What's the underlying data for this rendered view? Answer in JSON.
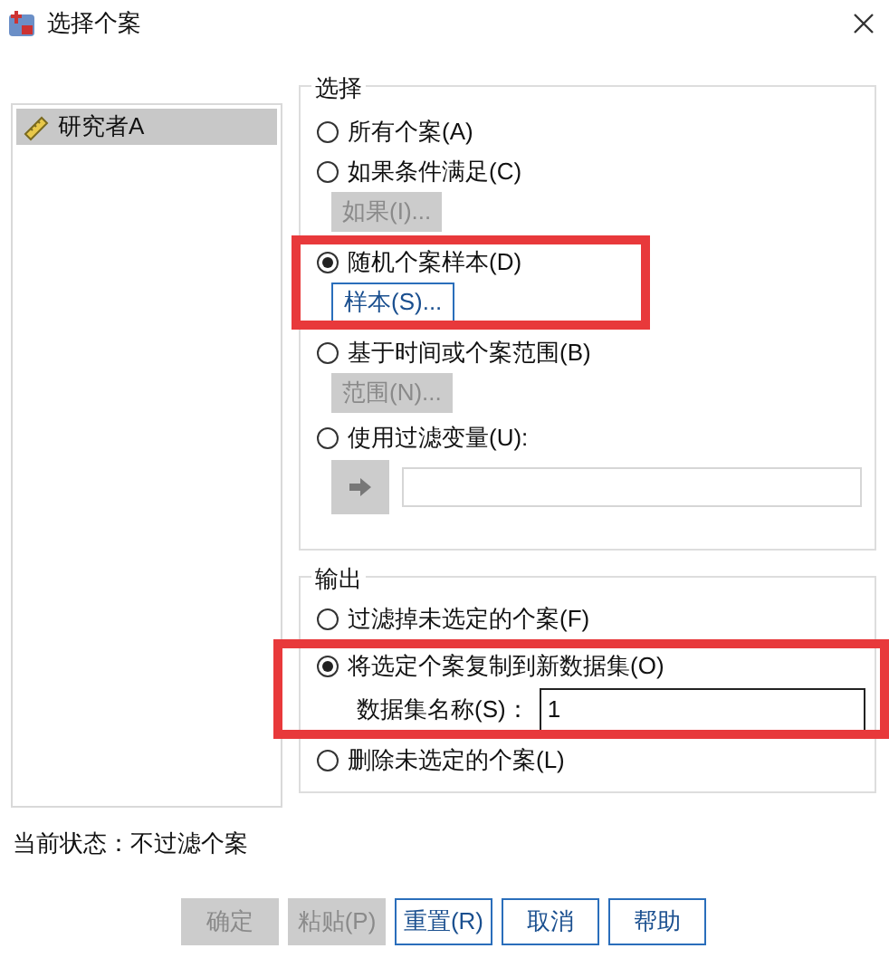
{
  "window": {
    "title": "选择个案"
  },
  "variables": [
    {
      "label": "研究者A",
      "selected": true
    }
  ],
  "selection": {
    "title": "选择",
    "options": [
      {
        "label": "所有个案(A)",
        "selected": false,
        "highlighted": false
      },
      {
        "label": "如果条件满足(C)",
        "selected": false,
        "highlighted": false,
        "button": {
          "label": "如果(I)...",
          "disabled": true
        }
      },
      {
        "label": "随机个案样本(D)",
        "selected": true,
        "highlighted": true,
        "button": {
          "label": "样本(S)...",
          "disabled": false
        }
      },
      {
        "label": "基于时间或个案范围(B)",
        "selected": false,
        "highlighted": false,
        "button": {
          "label": "范围(N)...",
          "disabled": true
        }
      },
      {
        "label": "使用过滤变量(U):",
        "selected": false,
        "highlighted": false,
        "variable_field": {
          "disabled": true
        }
      }
    ]
  },
  "output": {
    "title": "输出",
    "options": [
      {
        "label": "过滤掉未选定的个案(F)",
        "selected": false,
        "highlighted": false
      },
      {
        "label": "将选定个案复制到新数据集(O)",
        "selected": true,
        "highlighted": true,
        "field": {
          "label": "数据集名称(S)：",
          "value": "1"
        }
      },
      {
        "label": "删除未选定的个案(L)",
        "selected": false,
        "highlighted": false
      }
    ]
  },
  "status": "当前状态：不过滤个案",
  "buttons": [
    {
      "label": "确定",
      "disabled": true
    },
    {
      "label": "粘贴(P)",
      "disabled": true
    },
    {
      "label": "重置(R)",
      "disabled": false
    },
    {
      "label": "取消",
      "disabled": false
    },
    {
      "label": "帮助",
      "disabled": false
    }
  ]
}
